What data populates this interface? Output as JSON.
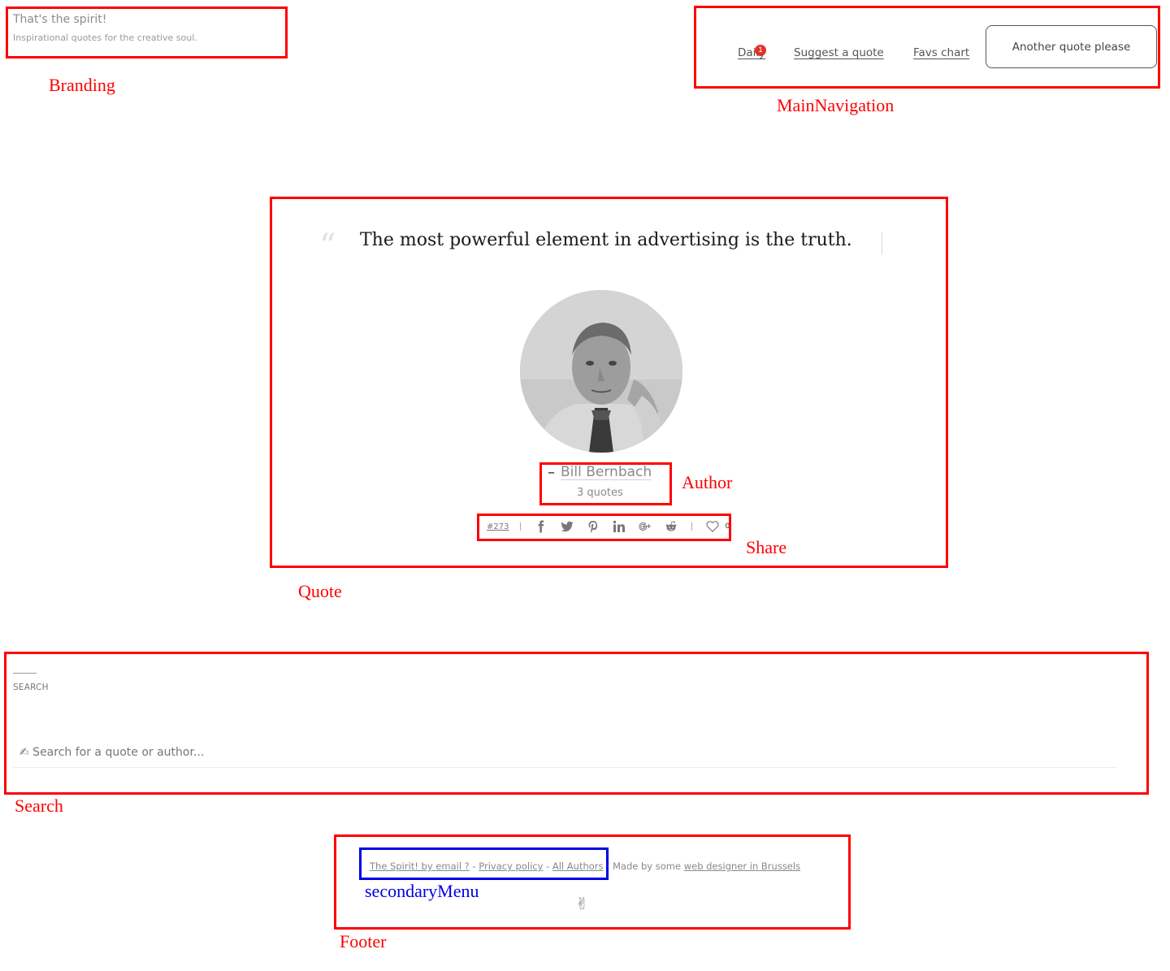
{
  "branding": {
    "title": "That's the spirit!",
    "tagline": "Inspirational quotes for the creative soul."
  },
  "navigation": {
    "daily_label": "Daily",
    "daily_badge": "1",
    "suggest_label": "Suggest a quote",
    "favs_label": "Favs chart",
    "another_button": "Another quote please"
  },
  "quote": {
    "open_mark": "“",
    "text": "The most powerful element in advertising is the truth.",
    "author_dash": "–",
    "author_name": "Bill Bernbach",
    "author_quote_count": "3 quotes",
    "share": {
      "id": "#273",
      "icons": [
        "facebook-icon",
        "twitter-icon",
        "pinterest-icon",
        "linkedin-icon",
        "google-plus-icon",
        "reddit-icon"
      ],
      "like_icon": "heart-icon",
      "like_count": "0"
    }
  },
  "search": {
    "heading": "SEARCH",
    "placeholder": "✍ Search for a quote or author..."
  },
  "footer": {
    "email_link": "The Spirit! by email ?",
    "sep1": " - ",
    "privacy_link": "Privacy policy",
    "sep2": " - ",
    "authors_link": "All Authors",
    "made_by": "Made by some ",
    "designer_link": "web designer in Brussels",
    "peace_symbol": "✌"
  },
  "annotations": {
    "branding": "Branding",
    "main_navigation": "MainNavigation",
    "author": "Author",
    "share": "Share",
    "quote": "Quote",
    "search": "Search",
    "secondary_menu": "secondaryMenu",
    "footer": "Footer"
  },
  "colors": {
    "annotation_red": "#ff0000",
    "annotation_blue": "#0000e6",
    "badge_red": "#e0322a"
  }
}
